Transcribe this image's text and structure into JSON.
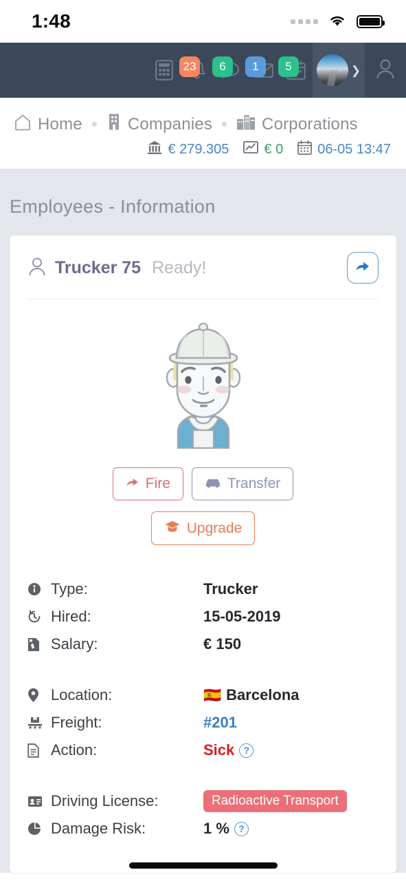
{
  "statusbar": {
    "time": "1:48",
    "signal_icon": "cellular-signal-icon",
    "wifi_icon": "wifi-icon",
    "battery_icon": "battery-full-icon"
  },
  "navbar": {
    "background": "#3a485a",
    "items": [
      {
        "icon": "calculator-icon",
        "badge": null,
        "badge_color": null
      },
      {
        "icon": "bell-icon",
        "badge": "23",
        "badge_color": "#f4875f"
      },
      {
        "icon": "chat-bubble-icon",
        "badge": "6",
        "badge_color": "#2cc08a"
      },
      {
        "icon": "envelope-icon",
        "badge": "1",
        "badge_color": "#5a9bdc"
      },
      {
        "icon": "calendar-icon",
        "badge": "5",
        "badge_color": "#2cc08a"
      }
    ],
    "profile": {
      "avatar_icon": "user-avatar-photo",
      "chevron_icon": "chevron-down-icon"
    },
    "user_icon": "user-outline-icon"
  },
  "breadcrumb": {
    "items": [
      {
        "icon": "home-icon",
        "label": "Home"
      },
      {
        "icon": "building-icon",
        "label": "Companies"
      },
      {
        "icon": "corporations-icon",
        "label": "Corporations"
      }
    ]
  },
  "finance": {
    "bank": {
      "icon": "bank-icon",
      "value": "€ 279.305",
      "color": "#4a86c4"
    },
    "stock": {
      "icon": "chart-line-icon",
      "value": "€ 0",
      "color": "#3aa06e"
    },
    "date": {
      "icon": "calendar-icon",
      "value": "06-05 13:47",
      "color": "#4a86c4"
    }
  },
  "page": {
    "title": "Employees - Information"
  },
  "card": {
    "user_icon": "user-outline-icon",
    "employee_name": "Trucker 75",
    "employee_status": "Ready!",
    "share_icon": "share-arrow-icon",
    "avatar_illustration": "trucker-avatar-illustration",
    "buttons": [
      {
        "label": "Fire",
        "icon": "share-arrow-icon",
        "color": "#e06a72"
      },
      {
        "label": "Transfer",
        "icon": "car-icon",
        "color": "#8d93b5"
      },
      {
        "label": "Upgrade",
        "icon": "graduation-cap-icon",
        "color": "#ec7b52"
      }
    ],
    "detail_groups": [
      {
        "rows": [
          {
            "icon": "info-circle-icon",
            "label": "Type:",
            "value": "Trucker",
            "style": "dark"
          },
          {
            "icon": "history-icon",
            "label": "Hired:",
            "value": "15-05-2019",
            "style": "dark"
          },
          {
            "icon": "invoice-icon",
            "label": "Salary:",
            "value": "€ 150",
            "style": "dark"
          }
        ]
      },
      {
        "rows": [
          {
            "icon": "map-pin-icon",
            "label": "Location:",
            "value": "Barcelona",
            "style": "dark",
            "flag": "🇪🇸"
          },
          {
            "icon": "pallet-icon",
            "label": "Freight:",
            "value": "#201",
            "style": "blue"
          },
          {
            "icon": "file-icon",
            "label": "Action:",
            "value": "Sick",
            "style": "red",
            "help": true
          }
        ]
      },
      {
        "rows": [
          {
            "icon": "id-card-icon",
            "label": "Driving License:",
            "value": "Radioactive Transport",
            "style": "pill",
            "pill_color": "#ec6e79"
          },
          {
            "icon": "pie-chart-icon",
            "label": "Damage Risk:",
            "value": "1 %",
            "style": "dark",
            "help": true
          }
        ]
      }
    ]
  },
  "home_indicator": "home-indicator-bar"
}
